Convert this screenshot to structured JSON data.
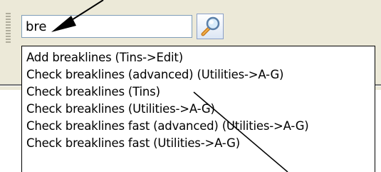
{
  "search": {
    "value": "bre"
  },
  "dropdown": {
    "items": [
      "Add breaklines (Tins->Edit)",
      "Check breaklines (advanced) (Utilities->A-G)",
      "Check breaklines (Tins)",
      "Check breaklines (Utilities->A-G)",
      "Check breaklines fast (advanced) (Utilities->A-G)",
      "Check breaklines fast (Utilities->A-G)"
    ]
  },
  "colors": {
    "toolbar_bg": "#ece9d8",
    "input_border": "#7f9db9"
  },
  "icons": {
    "search_button": "magnifier-icon",
    "grip": "grip-icon"
  }
}
